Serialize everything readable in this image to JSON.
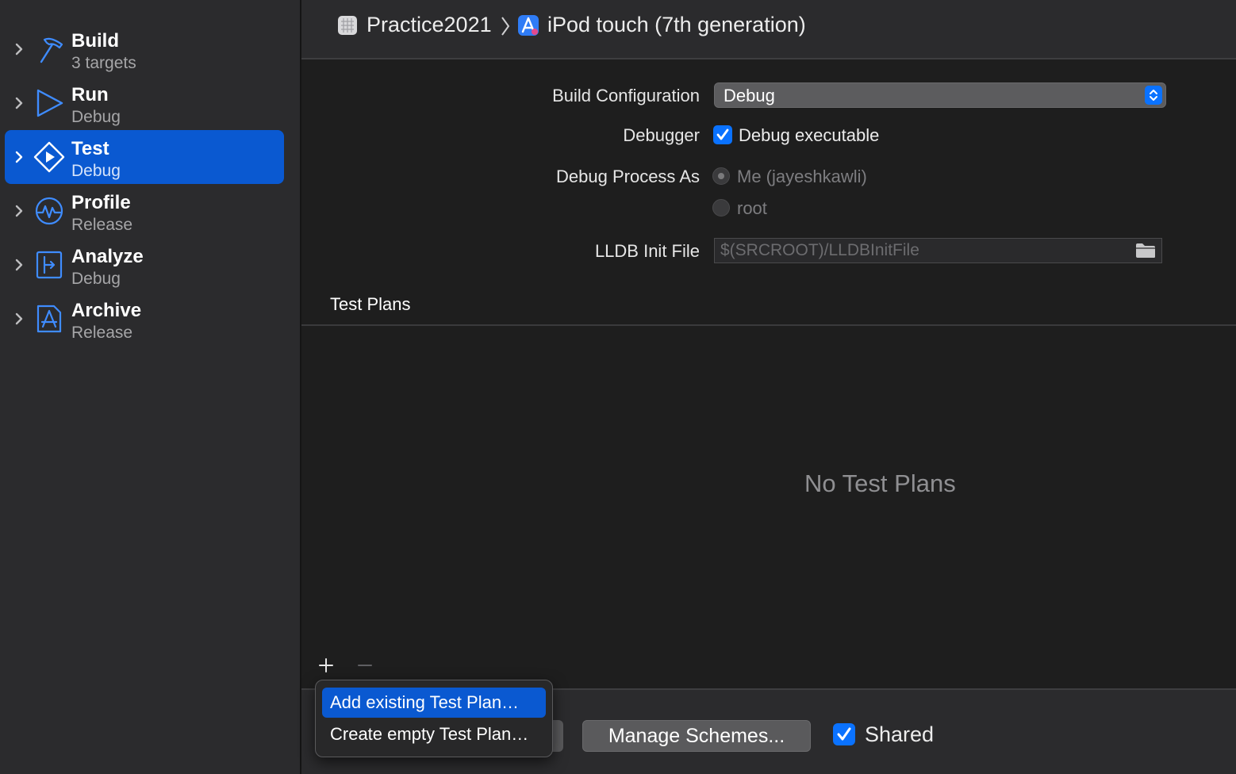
{
  "sidebar": {
    "items": [
      {
        "title": "Build",
        "subtitle": "3 targets",
        "icon": "hammer-icon",
        "selected": false
      },
      {
        "title": "Run",
        "subtitle": "Debug",
        "icon": "play-icon",
        "selected": false
      },
      {
        "title": "Test",
        "subtitle": "Debug",
        "icon": "test-diamond-icon",
        "selected": true
      },
      {
        "title": "Profile",
        "subtitle": "Release",
        "icon": "instruments-waveform-icon",
        "selected": false
      },
      {
        "title": "Analyze",
        "subtitle": "Debug",
        "icon": "analyze-icon",
        "selected": false
      },
      {
        "title": "Archive",
        "subtitle": "Release",
        "icon": "archive-appstore-icon",
        "selected": false
      }
    ]
  },
  "breadcrumb": {
    "project": "Practice2021",
    "destination": "iPod touch (7th generation)"
  },
  "form": {
    "build_configuration_label": "Build Configuration",
    "build_configuration_value": "Debug",
    "debugger_label": "Debugger",
    "debug_executable_label": "Debug executable",
    "debug_executable_checked": true,
    "debug_process_as_label": "Debug Process As",
    "process_options": [
      "Me (jayeshkawli)",
      "root"
    ],
    "process_selected": "Me (jayeshkawli)",
    "lldb_init_file_label": "LLDB Init File",
    "lldb_init_file_placeholder": "$(SRCROOT)/LLDBInitFile"
  },
  "test_plans": {
    "section_title": "Test Plans",
    "empty_message": "No Test Plans",
    "add_symbol": "+",
    "remove_symbol": "−"
  },
  "popup_menu": {
    "items": [
      "Add existing Test Plan…",
      "Create empty Test Plan…"
    ],
    "highlighted": "Add existing Test Plan…"
  },
  "footer": {
    "manage_schemes_label": "Manage Schemes...",
    "shared_label": "Shared",
    "shared_checked": true
  },
  "colors": {
    "accent": "#0a72ff",
    "selection": "#0a59d1",
    "background": "#1e1e1e",
    "panel": "#2b2b2d"
  }
}
